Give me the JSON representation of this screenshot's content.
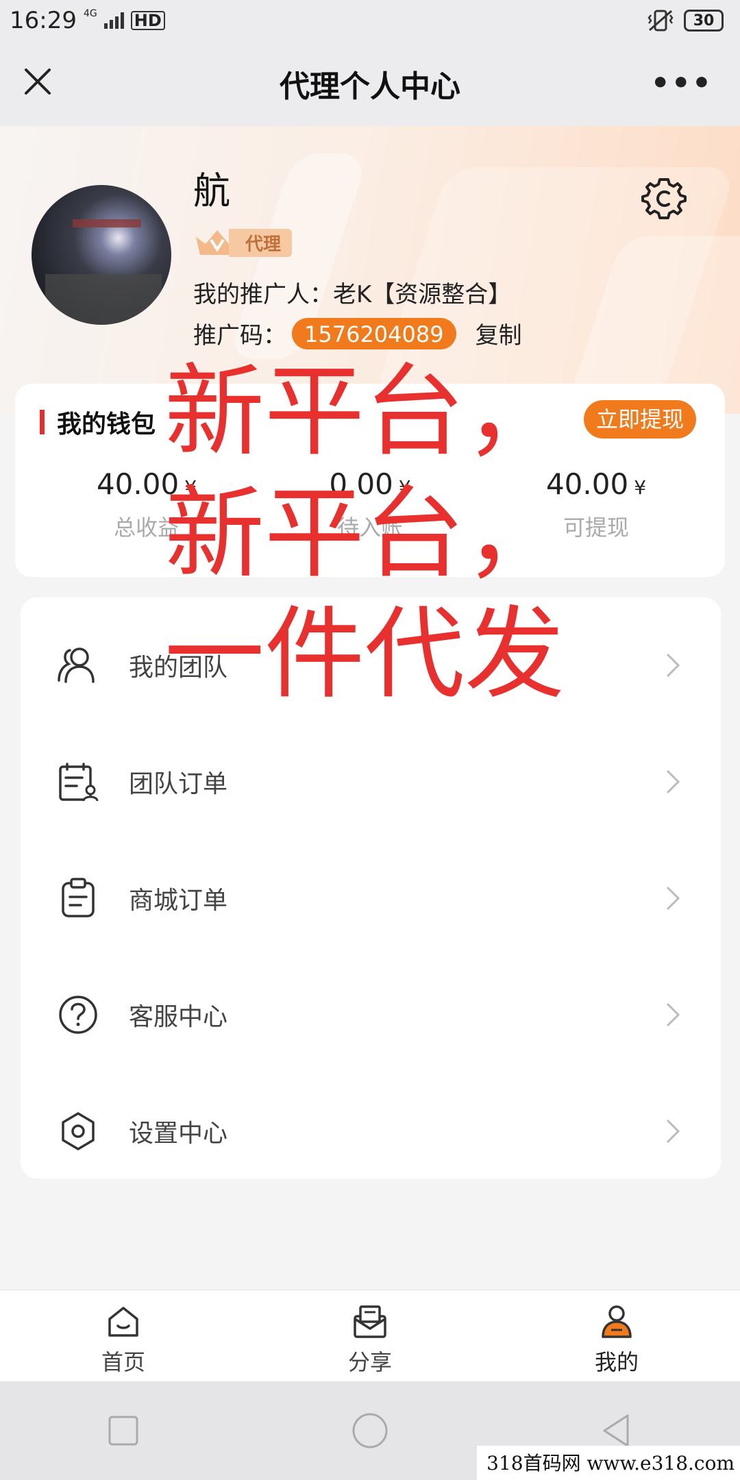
{
  "status_bar": {
    "time": "16:29",
    "network": "4G",
    "hd": "HD",
    "battery": "30"
  },
  "title_bar": {
    "title": "代理个人中心",
    "more": "•••"
  },
  "profile": {
    "name": "航",
    "role_badge": "代理",
    "referrer": "我的推广人：老K【资源整合】",
    "promo_label": "推广码：",
    "promo_code": "1576204089",
    "copy_label": "复制"
  },
  "wallet": {
    "title": "我的钱包",
    "withdraw_label": "立即提现",
    "stats": [
      {
        "value": "40.00",
        "unit": "¥",
        "label": "总收益"
      },
      {
        "value": "0.00",
        "unit": "¥",
        "label": "待入账"
      },
      {
        "value": "40.00",
        "unit": "¥",
        "label": "可提现"
      }
    ]
  },
  "menu": {
    "items": [
      {
        "label": "我的团队",
        "icon": "team-icon"
      },
      {
        "label": "团队订单",
        "icon": "team-order-icon"
      },
      {
        "label": "商城订单",
        "icon": "clipboard-icon"
      },
      {
        "label": "客服中心",
        "icon": "help-icon"
      },
      {
        "label": "设置中心",
        "icon": "hexagon-settings-icon"
      }
    ]
  },
  "overlay": {
    "line1": "新平台，",
    "line2": "新平台，",
    "line3": "一件代发"
  },
  "tabbar": {
    "items": [
      {
        "label": "首页",
        "icon": "home-icon"
      },
      {
        "label": "分享",
        "icon": "share-icon"
      },
      {
        "label": "我的",
        "icon": "profile-icon"
      }
    ]
  },
  "watermark": "318首码网 www.e318.com",
  "colors": {
    "accent": "#f07a1c",
    "overlay_red": "#e8302e",
    "wallet_bar": "#e23030"
  }
}
